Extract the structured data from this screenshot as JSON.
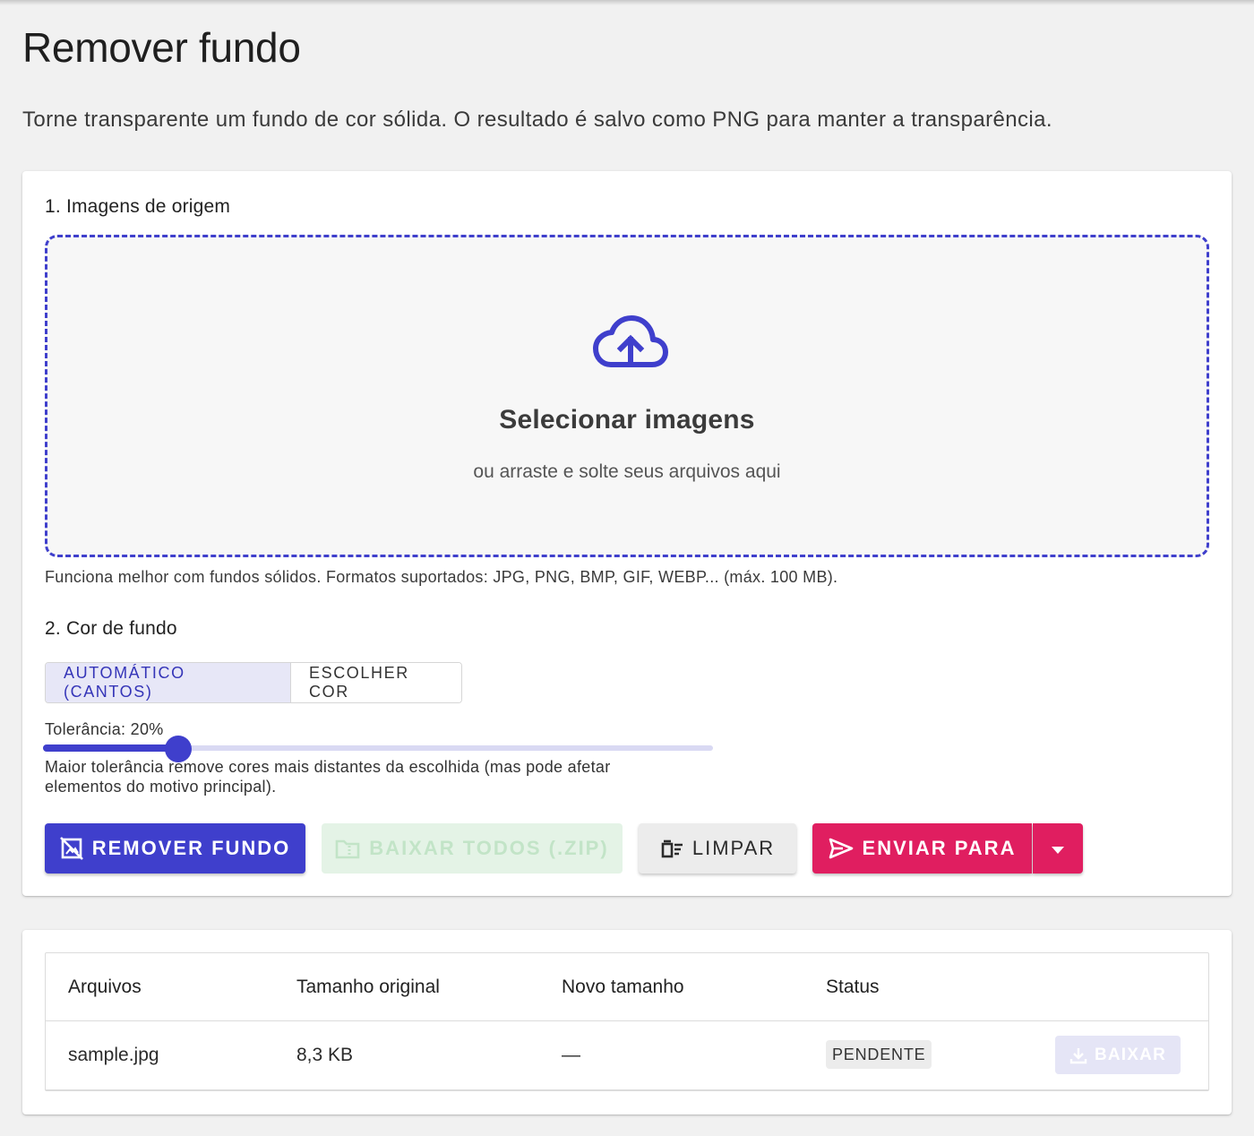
{
  "page": {
    "title": "Remover fundo",
    "description": "Torne transparente um fundo de cor sólida. O resultado é salvo como PNG para manter a transparência."
  },
  "source": {
    "section_title": "1. Imagens de origem",
    "dropzone_title": "Selecionar imagens",
    "dropzone_subtitle": "ou arraste e solte seus arquivos aqui",
    "hint": "Funciona melhor com fundos sólidos. Formatos suportados: JPG, PNG, BMP, GIF, WEBP... (máx. 100 MB)."
  },
  "background": {
    "section_title": "2. Cor de fundo",
    "options": [
      "AUTOMÁTICO (CANTOS)",
      "ESCOLHER COR"
    ],
    "selected_option": "AUTOMÁTICO (CANTOS)",
    "tolerance_label": "Tolerância: 20%",
    "tolerance_value": 20,
    "tolerance_help": "Maior tolerância remove cores mais distantes da escolhida (mas pode afetar elementos do motivo principal)."
  },
  "actions": {
    "remove_label": "REMOVER FUNDO",
    "zip_label": "BAIXAR TODOS (.ZIP)",
    "clear_label": "LIMPAR",
    "send_label": "ENVIAR PARA"
  },
  "icons": {
    "upload": "cloud-upload-icon",
    "remove": "hide-image-icon",
    "zip": "folder-zip-icon",
    "clear": "clear-all-icon",
    "send": "send-icon",
    "dropdown": "arrow-drop-down-icon",
    "download": "download-icon"
  },
  "colors": {
    "primary": "#3f3fcc",
    "send": "#e01e60",
    "zip_disabled": "#e4f3e6"
  },
  "files_table": {
    "headers": [
      "Arquivos",
      "Tamanho original",
      "Novo tamanho",
      "Status"
    ],
    "rows": [
      {
        "name": "sample.jpg",
        "original_size": "8,3 KB",
        "new_size": "—",
        "status": "PENDENTE",
        "download_label": "BAIXAR"
      }
    ]
  }
}
